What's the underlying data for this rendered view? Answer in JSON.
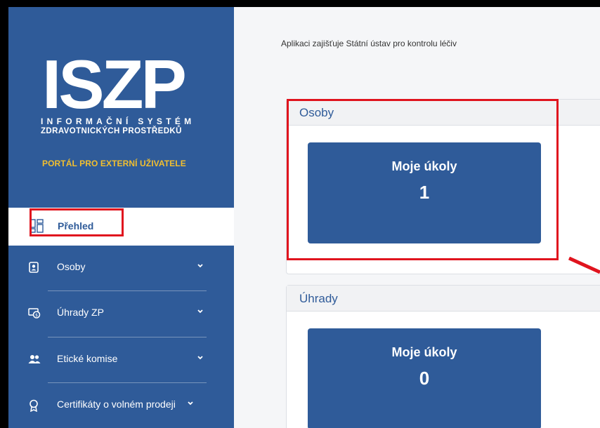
{
  "logo": {
    "big": "ISZP",
    "line1": "INFORMAČNÍ SYSTÉM",
    "line2": "ZDRAVOTNICKÝCH PROSTŘEDKŮ"
  },
  "portal_label": "PORTÁL PRO EXTERNÍ UŽIVATELE",
  "nav": {
    "active": {
      "label": "Přehled",
      "icon": "dashboard-icon"
    },
    "items": [
      {
        "label": "Osoby",
        "icon": "person-document-icon"
      },
      {
        "label": "Úhrady ZP",
        "icon": "money-icon"
      },
      {
        "label": "Etické komise",
        "icon": "users-icon"
      },
      {
        "label": "Certifikáty o volném prodeji",
        "icon": "certificate-icon"
      }
    ]
  },
  "notice": "Aplikaci zajišťuje Státní ústav pro kontrolu léčiv",
  "panels": [
    {
      "title": "Osoby",
      "card_title": "Moje úkoly",
      "count": "1"
    },
    {
      "title": "Úhrady",
      "card_title": "Moje úkoly",
      "count": "0"
    }
  ],
  "colors": {
    "sidebar": "#2f5b99",
    "accent_yellow": "#f2bf2f",
    "highlight_red": "#e0141e"
  }
}
